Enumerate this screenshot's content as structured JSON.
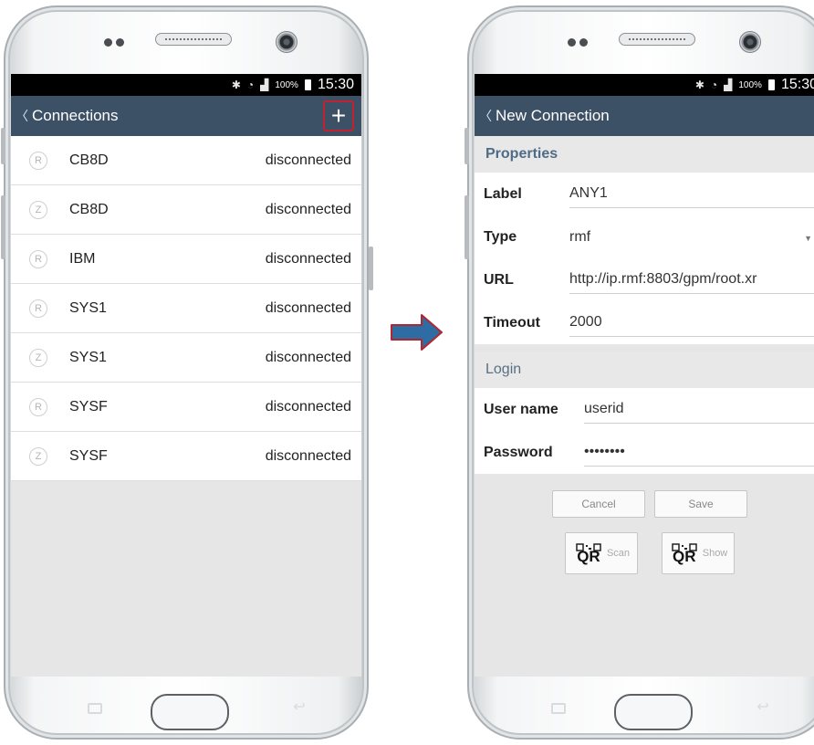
{
  "status_bar": {
    "battery_percent": "100%",
    "time": "15:30",
    "icons": [
      "bluetooth-icon",
      "wifi-icon",
      "signal-icon",
      "battery-icon"
    ]
  },
  "connections_screen": {
    "title": "Connections",
    "add_button": "+",
    "items": [
      {
        "badge": "R",
        "name": "CB8D",
        "status": "disconnected"
      },
      {
        "badge": "Z",
        "name": "CB8D",
        "status": "disconnected"
      },
      {
        "badge": "R",
        "name": "IBM",
        "status": "disconnected"
      },
      {
        "badge": "R",
        "name": "SYS1",
        "status": "disconnected"
      },
      {
        "badge": "Z",
        "name": "SYS1",
        "status": "disconnected"
      },
      {
        "badge": "R",
        "name": "SYSF",
        "status": "disconnected"
      },
      {
        "badge": "Z",
        "name": "SYSF",
        "status": "disconnected"
      }
    ]
  },
  "new_connection_screen": {
    "title": "New Connection",
    "properties_header": "Properties",
    "fields": {
      "label": {
        "label": "Label",
        "value": "ANY1"
      },
      "type": {
        "label": "Type",
        "value": "rmf"
      },
      "url": {
        "label": "URL",
        "value": "http://ip.rmf:8803/gpm/root.xr"
      },
      "timeout": {
        "label": "Timeout",
        "value": "2000"
      }
    },
    "login_header": "Login",
    "login": {
      "user_name": {
        "label": "User name",
        "value": "userid"
      },
      "password": {
        "label": "Password",
        "value": "••••••••"
      }
    },
    "buttons": {
      "cancel": "Cancel",
      "save": "Save",
      "qr_text": "QR",
      "scan": "Scan",
      "show": "Show"
    }
  },
  "colors": {
    "app_bar": "#3d5166",
    "highlight": "#c0232f",
    "arrow": "#2e6da4"
  }
}
